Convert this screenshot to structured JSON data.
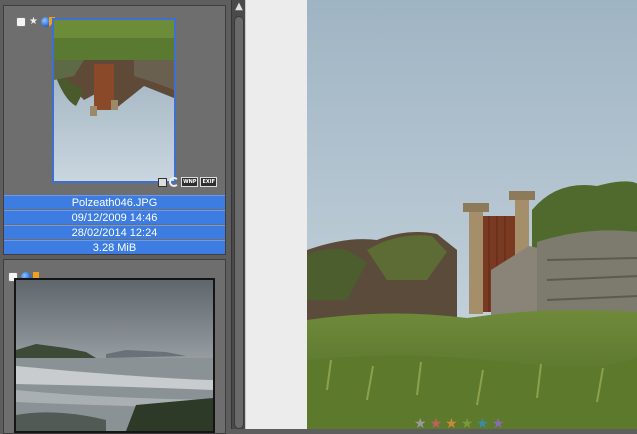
{
  "thumbbar": {
    "items": [
      {
        "filename": "Polzeath046.JPG",
        "date_taken": "09/12/2009 14:46",
        "date_modified": "28/02/2014 12:24",
        "size": "3.28 MiB",
        "selected": true,
        "orientation": "rotated-180"
      },
      {
        "selected": false,
        "description": "seascape"
      }
    ],
    "badge_icons": [
      "checkbox-icon",
      "star-icon",
      "color-label-icon",
      "bookmark-icon"
    ],
    "overlay_icons": [
      "resize-icon",
      "rotate-icon",
      "wnp-icon",
      "exif-icon"
    ],
    "overlay_labels": {
      "wnp": "WNP",
      "exif": "EXIF"
    },
    "star_symbol": "★"
  },
  "scrollbar": {
    "up_arrow": "▲"
  },
  "viewer": {
    "rating_stars": [
      "★",
      "★",
      "★",
      "★",
      "★",
      "★"
    ],
    "rating_colors": [
      "#9a9a9a",
      "#c0605a",
      "#c88a3a",
      "#7a9a3a",
      "#3a8aa8",
      "#8a6ab0"
    ]
  },
  "colors": {
    "selection": "#3d7ce0",
    "thumbbar_bg": "#5e5e5e",
    "viewer_bg": "#ececec"
  }
}
